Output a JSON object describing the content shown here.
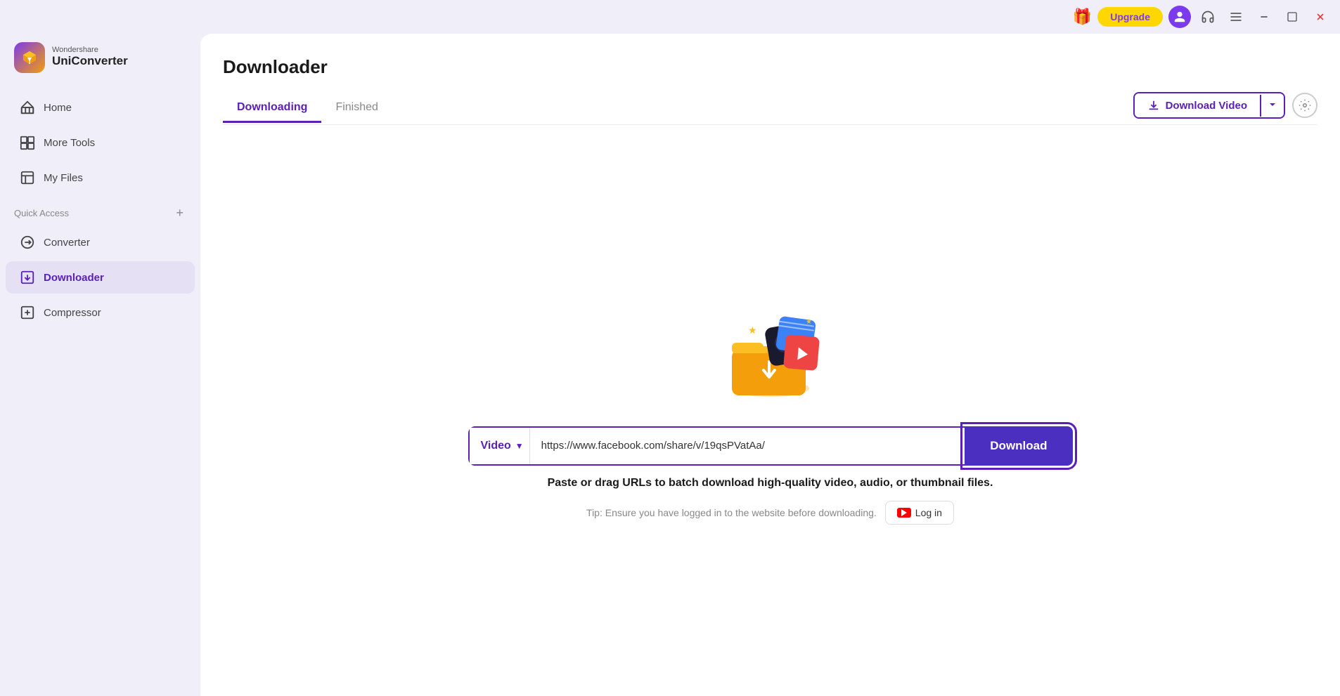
{
  "app": {
    "brand": "Wondershare",
    "product": "UniConverter"
  },
  "titlebar": {
    "upgrade_label": "Upgrade",
    "minimize_icon": "─",
    "maximize_icon": "⧉",
    "close_icon": "✕",
    "menu_icon": "≡"
  },
  "sidebar": {
    "nav_items": [
      {
        "id": "home",
        "label": "Home",
        "icon": "home"
      },
      {
        "id": "more-tools",
        "label": "More Tools",
        "icon": "more-tools"
      },
      {
        "id": "my-files",
        "label": "My Files",
        "icon": "my-files"
      }
    ],
    "quick_access_label": "Quick Access",
    "quick_access_items": [
      {
        "id": "converter",
        "label": "Converter",
        "icon": "converter"
      },
      {
        "id": "downloader",
        "label": "Downloader",
        "icon": "downloader",
        "active": true
      },
      {
        "id": "compressor",
        "label": "Compressor",
        "icon": "compressor"
      }
    ]
  },
  "main": {
    "page_title": "Downloader",
    "tabs": [
      {
        "id": "downloading",
        "label": "Downloading",
        "active": true
      },
      {
        "id": "finished",
        "label": "Finished",
        "active": false
      }
    ],
    "download_video_button": "Download Video",
    "url_input": {
      "type_label": "Video",
      "placeholder": "https://www.facebook.com/share/v/19qsPVatAa/",
      "value": "https://www.facebook.com/share/v/19qsPVatAa/"
    },
    "download_button_label": "Download",
    "hint_text": "Paste or drag URLs to batch download high-quality video, audio, or thumbnail files.",
    "tip_text": "Tip: Ensure you have logged in to the website before downloading.",
    "login_button_label": "Log in"
  }
}
